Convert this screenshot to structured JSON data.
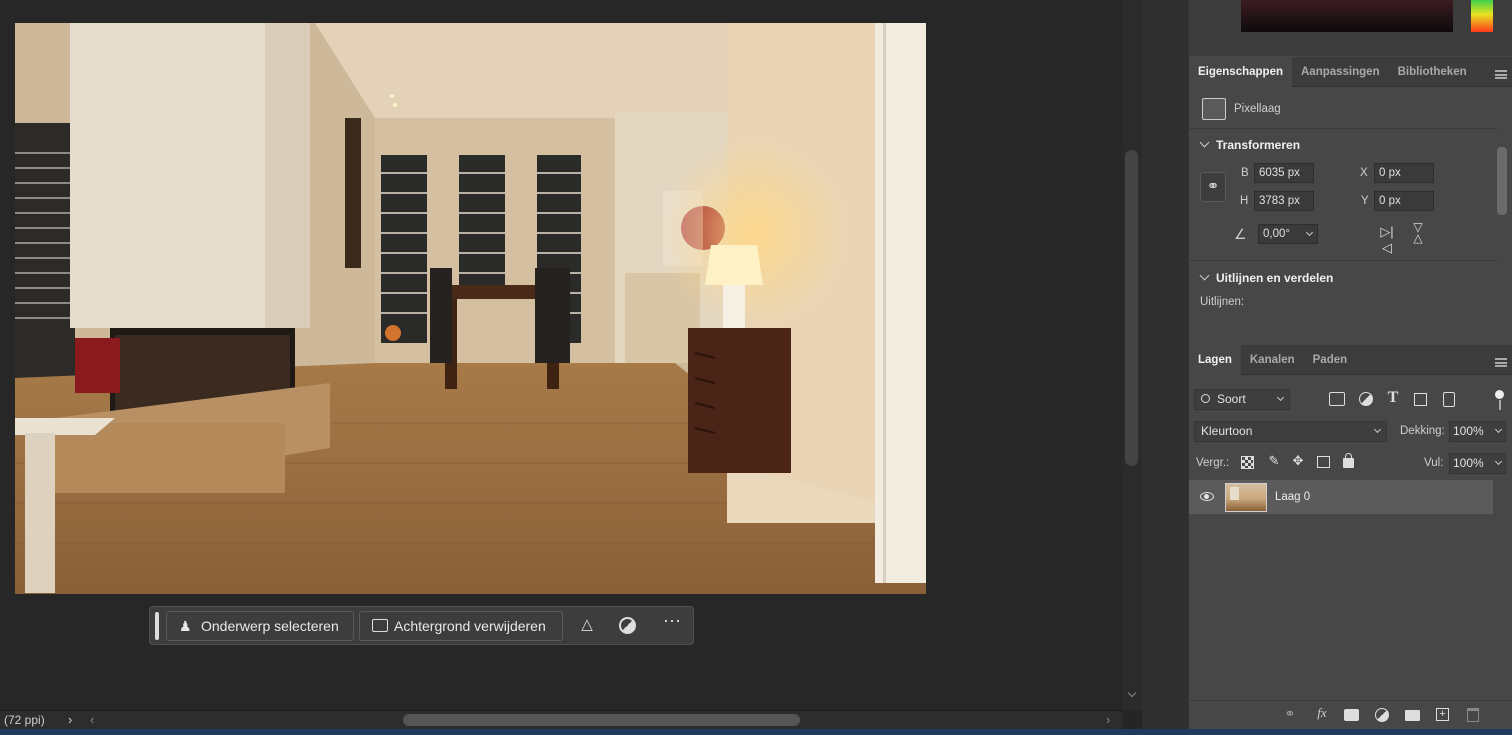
{
  "properties_panel": {
    "tabs": [
      "Eigenschappen",
      "Aanpassingen",
      "Bibliotheken"
    ],
    "layer_kind": "Pixellaag",
    "transform": {
      "title": "Transformeren",
      "width_label": "B",
      "width_value": "6035 px",
      "height_label": "H",
      "height_value": "3783 px",
      "x_label": "X",
      "x_value": "0 px",
      "y_label": "Y",
      "y_value": "0 px",
      "angle_value": "0,00°"
    },
    "align": {
      "title": "Uitlijnen en verdelen",
      "align_label": "Uitlijnen:"
    }
  },
  "layers_panel": {
    "tabs": [
      "Lagen",
      "Kanalen",
      "Paden"
    ],
    "filter_label": "Soort",
    "blend_mode": "Kleurtoon",
    "opacity_label": "Dekking:",
    "opacity_value": "100%",
    "lock_label": "Vergr.:",
    "fill_label": "Vul:",
    "fill_value": "100%",
    "layers": [
      {
        "name": "Laag 0",
        "visible": true
      }
    ]
  },
  "contextual_taskbar": {
    "select_subject": "Onderwerp selecteren",
    "remove_background": "Achtergrond verwijderen"
  },
  "status_bar": {
    "resolution": "(72 ppi)"
  },
  "colors": {
    "panel_bg": "#474747",
    "canvas_bg": "#272727",
    "selected_layer": "#5b5b5b"
  }
}
